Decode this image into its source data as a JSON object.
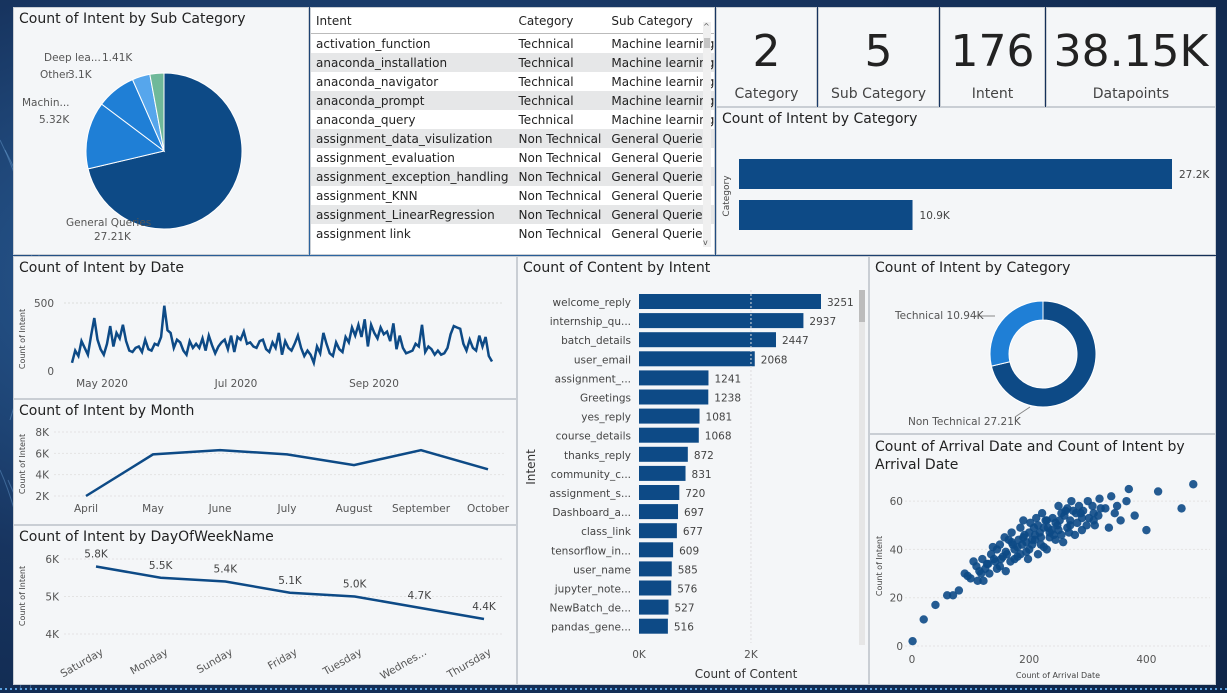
{
  "cards": [
    {
      "value": "2",
      "label": "Category"
    },
    {
      "value": "5",
      "label": "Sub Category"
    },
    {
      "value": "176",
      "label": "Intent"
    },
    {
      "value": "38.15K",
      "label": "Datapoints"
    }
  ],
  "colors": {
    "primary": "#0d4a86",
    "secondary": "#1f7fd6",
    "light": "#56a6ec",
    "teal": "#6fb99a"
  },
  "intent_table": {
    "headers": [
      "Intent",
      "Category",
      "Sub Category"
    ],
    "rows": [
      [
        "activation_function",
        "Technical",
        "Machine learning"
      ],
      [
        "anaconda_installation",
        "Technical",
        "Machine learning"
      ],
      [
        "anaconda_navigator",
        "Technical",
        "Machine learning"
      ],
      [
        "anaconda_prompt",
        "Technical",
        "Machine learning"
      ],
      [
        "anaconda_query",
        "Technical",
        "Machine learning"
      ],
      [
        "assignment_data_visulization",
        "Non Technical",
        "General Queries"
      ],
      [
        "assignment_evaluation",
        "Non Technical",
        "General Queries"
      ],
      [
        "assignment_exception_handling",
        "Non Technical",
        "General Queries"
      ],
      [
        "assignment_KNN",
        "Non Technical",
        "General Queries"
      ],
      [
        "assignment_LinearRegression",
        "Non Technical",
        "General Queries"
      ],
      [
        "assignment link",
        "Non Technical",
        "General Queries"
      ]
    ]
  },
  "chart_data": [
    {
      "id": "subcat_pie",
      "type": "pie",
      "title": "Count of Intent by Sub Category",
      "slices": [
        {
          "label": "General Queries",
          "value_label": "27.21K",
          "value": 27210
        },
        {
          "label": "Machin...",
          "value_label": "5.32K",
          "value": 5320
        },
        {
          "label": "Other",
          "value_label": "3.1K",
          "value": 3100
        },
        {
          "label": "Deep lea...",
          "value_label": "1.41K",
          "value": 1410
        },
        {
          "label": "",
          "value_label": "",
          "value": 1110
        }
      ]
    },
    {
      "id": "category_bar",
      "type": "bar",
      "title": "Count of Intent by Category",
      "ylabel": "Category",
      "values": [
        27200,
        10900
      ],
      "value_labels": [
        "27.2K",
        "10.9K"
      ]
    },
    {
      "id": "date_line",
      "type": "line",
      "title": "Count of Intent by Date",
      "ylabel": "Count of Intent",
      "ylim": [
        0,
        500
      ],
      "yticks": [
        "0",
        "500"
      ],
      "xticks": [
        "May 2020",
        "Jul 2020",
        "Sep 2020"
      ],
      "values": [
        60,
        150,
        110,
        220,
        170,
        120,
        260,
        390,
        230,
        160,
        120,
        200,
        330,
        180,
        280,
        240,
        340,
        220,
        150,
        140,
        170,
        180,
        140,
        230,
        160,
        150,
        200,
        190,
        250,
        480,
        300,
        280,
        170,
        230,
        210,
        150,
        120,
        220,
        170,
        200,
        170,
        240,
        150,
        260,
        190,
        130,
        180,
        210,
        230,
        160,
        260,
        140,
        250,
        230,
        290,
        200,
        210,
        180,
        170,
        220,
        230,
        160,
        140,
        210,
        170,
        280,
        120,
        220,
        170,
        150,
        200,
        260,
        170,
        110,
        150,
        120,
        60,
        180,
        130,
        280,
        200,
        130,
        110,
        210,
        160,
        140,
        250,
        210,
        320,
        260,
        340,
        250,
        380,
        180,
        340,
        280,
        240,
        320,
        270,
        290,
        220,
        350,
        160,
        260,
        170,
        130,
        140,
        150,
        200,
        180,
        340,
        140,
        180,
        160,
        120,
        150,
        120,
        130,
        170,
        270,
        330,
        320,
        310,
        200,
        150,
        230,
        170,
        150,
        260,
        180,
        250,
        110,
        70
      ]
    },
    {
      "id": "month_line",
      "type": "line",
      "title": "Count of Intent by Month",
      "ylabel": "Count of Intent",
      "ylim": [
        2000,
        8000
      ],
      "yticks": [
        "2K",
        "4K",
        "6K",
        "8K"
      ],
      "categories": [
        "April",
        "May",
        "June",
        "July",
        "August",
        "September",
        "October"
      ],
      "values": [
        2000,
        5900,
        6300,
        5900,
        4900,
        6300,
        4500
      ]
    },
    {
      "id": "dow_line",
      "type": "line",
      "title": "Count of Intent by DayOfWeekName",
      "ylabel": "Count of Intent",
      "ylim": [
        4000,
        6000
      ],
      "yticks": [
        "4K",
        "5K",
        "6K"
      ],
      "categories": [
        "Saturday",
        "Monday",
        "Sunday",
        "Friday",
        "Tuesday",
        "Wednes...",
        "Thursday"
      ],
      "values": [
        5800,
        5500,
        5400,
        5100,
        5000,
        4700,
        4400
      ],
      "value_labels": [
        "5.8K",
        "5.5K",
        "5.4K",
        "5.1K",
        "5.0K",
        "4.7K",
        "4.4K"
      ]
    },
    {
      "id": "content_bar",
      "type": "bar",
      "title": "Count of Content by Intent",
      "xlabel": "Count of Content",
      "ylabel": "Intent",
      "xticks": [
        "0K",
        "2K"
      ],
      "categories": [
        "welcome_reply",
        "internship_qu...",
        "batch_details",
        "user_email",
        "assignment_...",
        "Greetings",
        "yes_reply",
        "course_details",
        "thanks_reply",
        "community_c...",
        "assignment_s...",
        "Dashboard_a...",
        "class_link",
        "tensorflow_in...",
        "user_name",
        "jupyter_note...",
        "NewBatch_de...",
        "pandas_gene..."
      ],
      "values": [
        3251,
        2937,
        2447,
        2068,
        1241,
        1238,
        1081,
        1068,
        872,
        831,
        720,
        697,
        677,
        609,
        585,
        576,
        527,
        516
      ]
    },
    {
      "id": "category_donut",
      "type": "pie",
      "title": "Count of Intent by Category",
      "slices": [
        {
          "label": "Non Technical",
          "value_label": "27.21K",
          "value": 27210
        },
        {
          "label": "Technical",
          "value_label": "10.94K",
          "value": 10940
        }
      ]
    },
    {
      "id": "arrival_scatter",
      "type": "scatter",
      "title": "Count of Arrival Date and Count of Intent by Arrival Date",
      "xlabel": "Count of Arrival Date",
      "ylabel": "Count of Intent",
      "xlim": [
        0,
        500
      ],
      "ylim": [
        0,
        70
      ],
      "xticks": [
        "0",
        "200",
        "400"
      ],
      "yticks": [
        "0",
        "20",
        "40",
        "60"
      ],
      "points": [
        [
          1,
          2
        ],
        [
          20,
          11
        ],
        [
          40,
          17
        ],
        [
          60,
          21
        ],
        [
          70,
          21
        ],
        [
          80,
          23
        ],
        [
          90,
          30
        ],
        [
          95,
          29
        ],
        [
          100,
          28
        ],
        [
          105,
          35
        ],
        [
          110,
          33
        ],
        [
          115,
          31
        ],
        [
          120,
          36
        ],
        [
          125,
          32
        ],
        [
          130,
          34
        ],
        [
          135,
          38
        ],
        [
          140,
          36
        ],
        [
          145,
          40
        ],
        [
          150,
          42
        ],
        [
          155,
          37
        ],
        [
          160,
          39
        ],
        [
          165,
          44
        ],
        [
          170,
          43
        ],
        [
          175,
          40
        ],
        [
          180,
          41
        ],
        [
          185,
          38
        ],
        [
          190,
          45
        ],
        [
          195,
          43
        ],
        [
          200,
          47
        ],
        [
          205,
          44
        ],
        [
          210,
          46
        ],
        [
          215,
          50
        ],
        [
          220,
          45
        ],
        [
          225,
          49
        ],
        [
          230,
          52
        ],
        [
          235,
          47
        ],
        [
          240,
          53
        ],
        [
          245,
          51
        ],
        [
          250,
          48
        ],
        [
          255,
          55
        ],
        [
          260,
          54
        ],
        [
          265,
          57
        ],
        [
          270,
          52
        ],
        [
          275,
          56
        ],
        [
          280,
          55
        ],
        [
          285,
          58
        ],
        [
          290,
          53
        ],
        [
          300,
          60
        ],
        [
          310,
          55
        ],
        [
          320,
          61
        ],
        [
          330,
          57
        ],
        [
          340,
          62
        ],
        [
          350,
          58
        ],
        [
          370,
          65
        ],
        [
          400,
          48
        ],
        [
          420,
          64
        ],
        [
          460,
          57
        ],
        [
          480,
          67
        ],
        [
          150,
          33
        ],
        [
          160,
          31
        ],
        [
          175,
          36
        ],
        [
          185,
          49
        ],
        [
          195,
          39
        ],
        [
          205,
          42
        ],
        [
          215,
          38
        ],
        [
          225,
          41
        ],
        [
          235,
          45
        ],
        [
          245,
          44
        ],
        [
          255,
          46
        ],
        [
          265,
          49
        ],
        [
          170,
          47
        ],
        [
          190,
          52
        ],
        [
          200,
          40
        ],
        [
          210,
          44
        ],
        [
          220,
          42
        ],
        [
          230,
          40
        ],
        [
          250,
          58
        ],
        [
          270,
          50
        ],
        [
          290,
          48
        ],
        [
          310,
          52
        ],
        [
          145,
          32
        ],
        [
          132,
          30
        ],
        [
          128,
          34
        ],
        [
          180,
          37
        ],
        [
          158,
          45
        ],
        [
          168,
          35
        ],
        [
          188,
          42
        ],
        [
          198,
          36
        ],
        [
          208,
          49
        ],
        [
          218,
          47
        ],
        [
          228,
          52
        ],
        [
          238,
          48
        ],
        [
          248,
          50
        ],
        [
          258,
          43
        ],
        [
          268,
          47
        ],
        [
          278,
          46
        ],
        [
          288,
          55
        ],
        [
          298,
          50
        ],
        [
          308,
          58
        ],
        [
          318,
          54
        ],
        [
          112,
          27
        ],
        [
          118,
          30
        ],
        [
          122,
          27
        ],
        [
          138,
          41
        ],
        [
          142,
          35
        ],
        [
          152,
          36
        ],
        [
          162,
          38
        ],
        [
          172,
          42
        ],
        [
          182,
          44
        ],
        [
          192,
          46
        ],
        [
          202,
          51
        ],
        [
          212,
          53
        ],
        [
          222,
          55
        ],
        [
          232,
          49
        ],
        [
          242,
          46
        ],
        [
          252,
          52
        ],
        [
          262,
          56
        ],
        [
          272,
          60
        ],
        [
          282,
          51
        ],
        [
          292,
          56
        ],
        [
          302,
          53
        ],
        [
          312,
          50
        ],
        [
          322,
          57
        ],
        [
          336,
          49
        ],
        [
          346,
          55
        ],
        [
          356,
          52
        ],
        [
          366,
          60
        ],
        [
          380,
          54
        ]
      ]
    }
  ]
}
